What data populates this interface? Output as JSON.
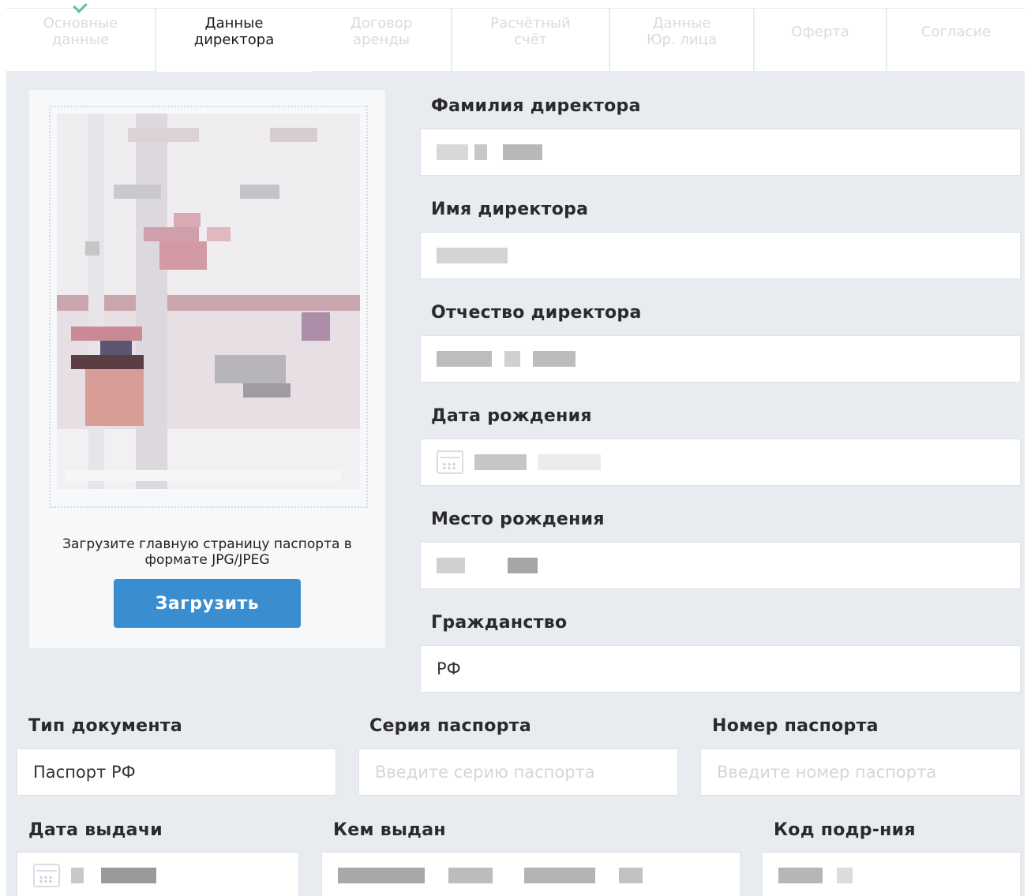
{
  "tabs": [
    {
      "label": "Основные\nданные",
      "state": "done"
    },
    {
      "label": "Данные\nдиректора",
      "state": "active"
    },
    {
      "label": "Договор\nаренды",
      "state": "disabled"
    },
    {
      "label": "Расчётный\nсчёт",
      "state": "disabled"
    },
    {
      "label": "Данные\nЮр. лица",
      "state": "disabled"
    },
    {
      "label": "Оферта",
      "state": "disabled"
    },
    {
      "label": "Согласие",
      "state": "disabled"
    }
  ],
  "upload": {
    "hint": "Загрузите главную страницу паспорта в\nформате JPG/JPEG",
    "button_label": "Загрузить"
  },
  "fields": {
    "last_name": {
      "label": "Фамилия директора",
      "value": ""
    },
    "first_name": {
      "label": "Имя директора",
      "value": ""
    },
    "patronymic": {
      "label": "Отчество директора",
      "value": ""
    },
    "birth_date": {
      "label": "Дата рождения",
      "value": ""
    },
    "birth_place": {
      "label": "Место рождения",
      "value": ""
    },
    "citizenship": {
      "label": "Гражданство",
      "value": "РФ"
    },
    "doc_type": {
      "label": "Тип документа",
      "value": "Паспорт РФ"
    },
    "passport_series": {
      "label": "Серия паспорта",
      "placeholder": "Введите серию паспорта"
    },
    "passport_number": {
      "label": "Номер паспорта",
      "placeholder": "Введите номер паспорта"
    },
    "issue_date": {
      "label": "Дата выдачи",
      "value": ""
    },
    "issued_by": {
      "label": "Кем выдан",
      "value": ""
    },
    "division_code": {
      "label": "Код подр-ния",
      "value": ""
    }
  },
  "colors": {
    "accent": "#3a8ed0",
    "check": "#5cc29a",
    "background": "#e8ebf0"
  }
}
